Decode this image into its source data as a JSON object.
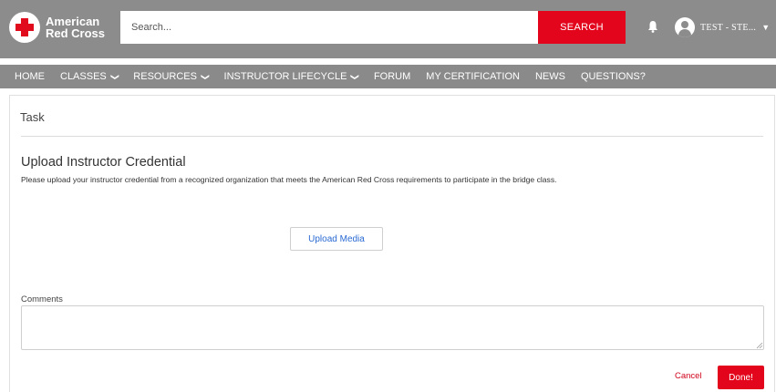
{
  "brand": {
    "line1": "American",
    "line2": "Red Cross",
    "color": "#e2051c"
  },
  "header": {
    "search": {
      "placeholder": "Search...",
      "button_label": "SEARCH"
    },
    "notifications_icon": "bell-icon",
    "user": {
      "name": "TEST - STE...",
      "avatar_icon": "user-avatar-icon",
      "caret_icon": "caret-down-icon"
    }
  },
  "nav": {
    "items": [
      {
        "label": "HOME",
        "dropdown": false
      },
      {
        "label": "CLASSES",
        "dropdown": true
      },
      {
        "label": "RESOURCES",
        "dropdown": true
      },
      {
        "label": "INSTRUCTOR LIFECYCLE",
        "dropdown": true
      },
      {
        "label": "FORUM",
        "dropdown": false
      },
      {
        "label": "MY CERTIFICATION",
        "dropdown": false
      },
      {
        "label": "NEWS",
        "dropdown": false
      },
      {
        "label": "QUESTIONS?",
        "dropdown": false
      }
    ]
  },
  "task": {
    "title": "Task",
    "section_title": "Upload Instructor Credential",
    "description": "Please upload your instructor credential from a recognized organization that meets the American Red Cross requirements to participate in the bridge class.",
    "upload_label": "Upload Media",
    "comments_label": "Comments",
    "comments_value": "",
    "cancel_label": "Cancel",
    "done_label": "Done!"
  }
}
